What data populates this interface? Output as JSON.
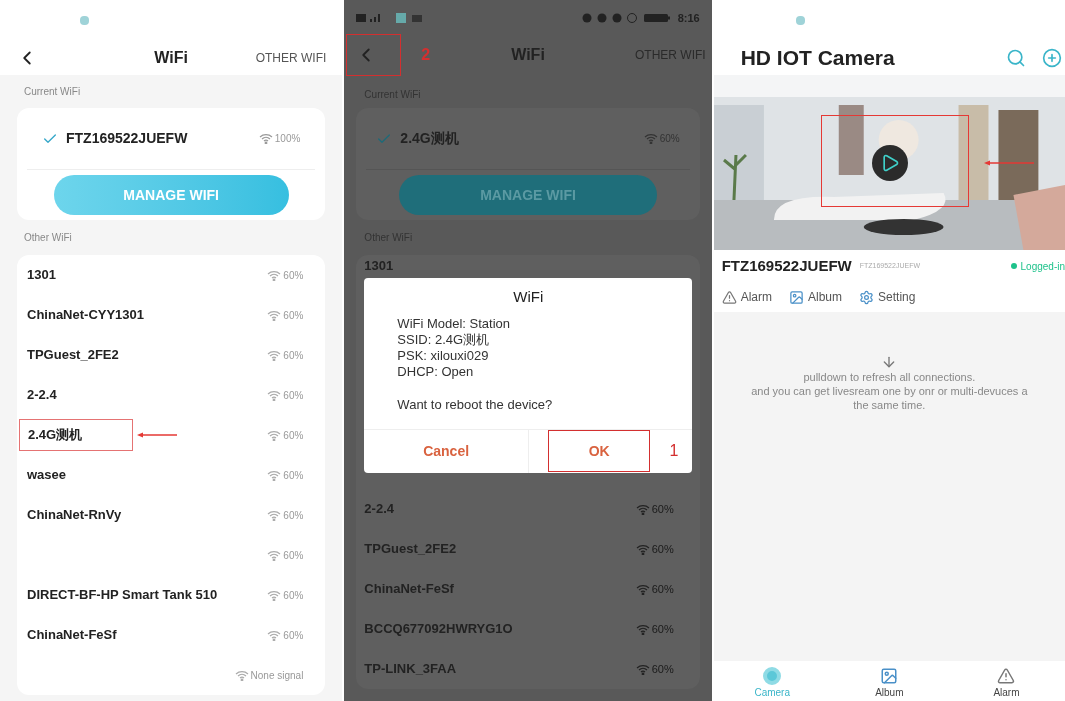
{
  "wifi_screen": {
    "title": "WiFi",
    "action": "OTHER WIFI",
    "current_label": "Current WiFi",
    "current": {
      "name": "FTZ169522JUEFW",
      "signal": "100%",
      "checked": true
    },
    "manage_button": "MANAGE WIFI",
    "other_label": "Other WiFi",
    "networks": [
      {
        "name": "1301",
        "signal": "60%",
        "annotated": false
      },
      {
        "name": "ChinaNet-CYY1301",
        "signal": "60%",
        "annotated": false
      },
      {
        "name": "TPGuest_2FE2",
        "signal": "60%",
        "annotated": false
      },
      {
        "name": "2-2.4",
        "signal": "60%",
        "annotated": false
      },
      {
        "name": "2.4G测机",
        "signal": "60%",
        "annotated": true
      },
      {
        "name": "wasee",
        "signal": "60%",
        "annotated": false
      },
      {
        "name": "ChinaNet-RnVy",
        "signal": "60%",
        "annotated": false
      },
      {
        "signal": "60%",
        "annotated": false
      },
      {
        "name": "DIRECT-BF-HP Smart Tank 510",
        "signal": "60%",
        "annotated": false
      },
      {
        "name": "ChinaNet-FeSf",
        "signal": "60%",
        "annotated": false
      },
      {
        "signal": "None signal",
        "annotated": false
      }
    ]
  },
  "reboot_screen": {
    "status_bar": {
      "time": "8:16"
    },
    "title": "WiFi",
    "action": "OTHER WIFI",
    "back_annotation": "2",
    "current_label": "Current WiFi",
    "current": {
      "name": "2.4G测机",
      "signal": "60%",
      "checked": true
    },
    "manage_button": "MANAGE WIFI",
    "other_label": "Other WiFi",
    "networks_above": [
      {
        "name": "1301"
      }
    ],
    "dialog": {
      "title": "WiFi",
      "lines": [
        "WiFi Model: Station",
        "SSID: 2.4G测机",
        "PSK: xilouxi029",
        "DHCP: Open"
      ],
      "question": "Want to reboot the device?",
      "buttons": [
        {
          "label": "Cancel",
          "annotated": false
        },
        {
          "label": "OK",
          "annotated": true,
          "annotation": "1"
        }
      ]
    },
    "networks_below": [
      {
        "name": "2-2.4",
        "signal": "60%"
      },
      {
        "name": "TPGuest_2FE2",
        "signal": "60%"
      },
      {
        "name": "ChinaNet-FeSf",
        "signal": "60%"
      },
      {
        "name": "BCCQ677092HWRYG1O",
        "signal": "60%"
      },
      {
        "name": "TP-LINK_3FAA",
        "signal": "60%"
      }
    ]
  },
  "camera_screen": {
    "title": "HD IOT Camera",
    "preview": {
      "kind": "picture",
      "annotated": true
    },
    "device": {
      "name": "FTZ169522JUEFW",
      "id": "FTZ169522JUEFW",
      "status": "Logged-in",
      "online": true
    },
    "actions": [
      {
        "label": "Alarm",
        "kind": "alarm"
      },
      {
        "label": "Album",
        "kind": "album"
      },
      {
        "label": "Setting",
        "kind": "setting"
      }
    ],
    "hint": [
      "pulldown to refresh all connections.",
      "and you can get livesream one by onr or multi-devuces a",
      "the same time."
    ],
    "tabs": [
      {
        "label": "Camera",
        "kind": "camera",
        "selected": true
      },
      {
        "label": "Album",
        "kind": "album",
        "selected": false
      },
      {
        "label": "Alarm",
        "kind": "alarm",
        "selected": false
      }
    ]
  }
}
